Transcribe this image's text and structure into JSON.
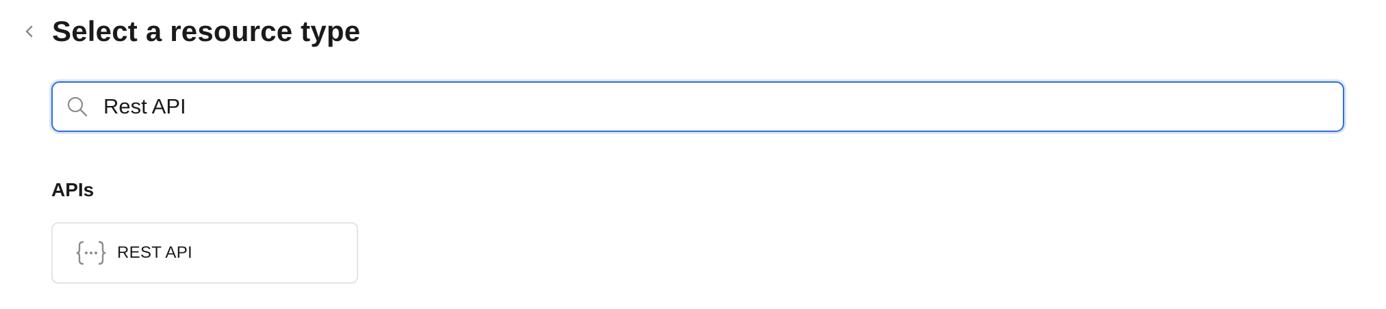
{
  "header": {
    "title": "Select a resource type",
    "back_icon": "chevron-left-icon"
  },
  "search": {
    "icon": "search-icon",
    "value": "Rest API",
    "focus_color": "#2f6fd6"
  },
  "sections": [
    {
      "heading": "APIs",
      "items": [
        {
          "label": "REST API",
          "icon": "curly-braces-icon"
        }
      ]
    }
  ]
}
